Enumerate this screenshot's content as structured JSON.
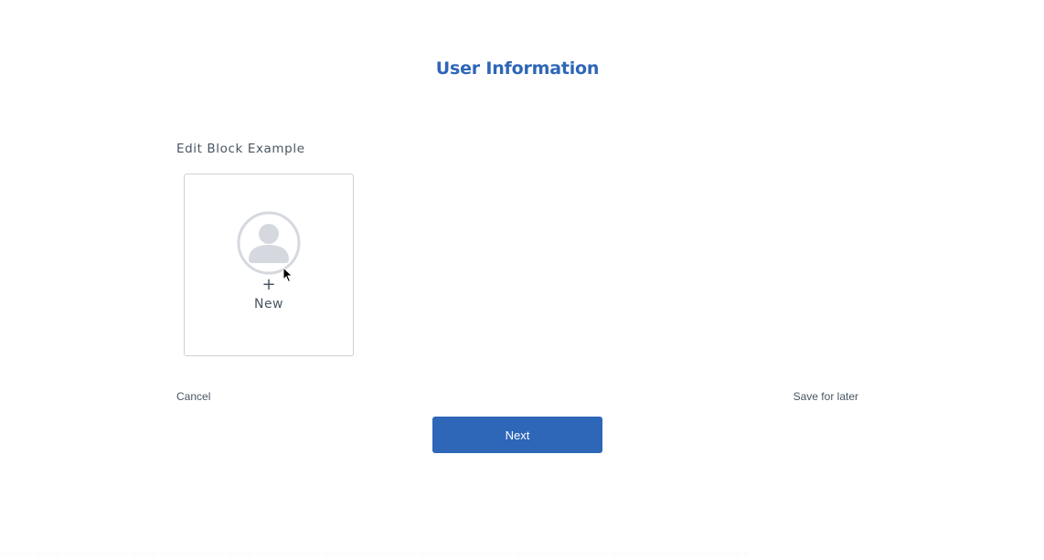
{
  "header": {
    "title": "User Information"
  },
  "section": {
    "label": "Edit Block Example"
  },
  "new_card": {
    "icon": "user-avatar-icon",
    "plus_glyph": "+",
    "label": "New"
  },
  "footer": {
    "cancel_label": "Cancel",
    "save_later_label": "Save for later",
    "next_label": "Next"
  },
  "colors": {
    "accent": "#2e66b8",
    "text": "#4a5563",
    "card_border": "#cdd1d6",
    "avatar": "#d5d9df"
  }
}
